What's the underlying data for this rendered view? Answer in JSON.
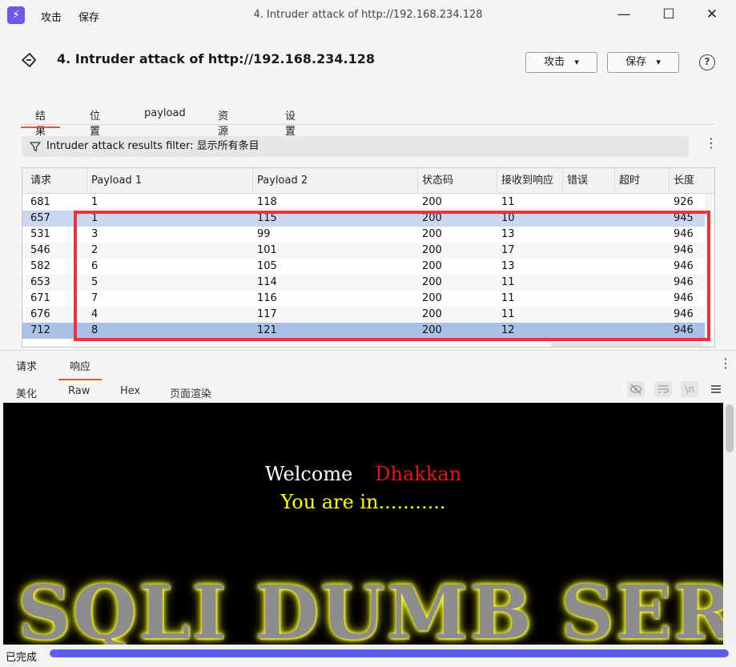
{
  "titlebar": {
    "menu": [
      "攻击",
      "保存"
    ],
    "window_title": "4. Intruder attack of http://192.168.234.128"
  },
  "header": {
    "title": "4. Intruder attack of http://192.168.234.128",
    "attack_button": "攻击",
    "save_button": "保存",
    "help": "?"
  },
  "tabs": [
    {
      "label": "结果",
      "active": true
    },
    {
      "label": "位置"
    },
    {
      "label": "payload"
    },
    {
      "label": "资源池"
    },
    {
      "label": "设置"
    }
  ],
  "filter": {
    "text": "Intruder attack results filter: 显示所有条目"
  },
  "table": {
    "columns": [
      "请求",
      "Payload 1",
      "Payload 2",
      "状态码",
      "接收到响应",
      "错误",
      "超时",
      "长度"
    ],
    "rows": [
      [
        "681",
        "1",
        "118",
        "200",
        "11",
        "",
        "",
        "926"
      ],
      [
        "657",
        "1",
        "115",
        "200",
        "10",
        "",
        "",
        "945"
      ],
      [
        "531",
        "3",
        "99",
        "200",
        "13",
        "",
        "",
        "946"
      ],
      [
        "546",
        "2",
        "101",
        "200",
        "17",
        "",
        "",
        "946"
      ],
      [
        "582",
        "6",
        "105",
        "200",
        "13",
        "",
        "",
        "946"
      ],
      [
        "653",
        "5",
        "114",
        "200",
        "11",
        "",
        "",
        "946"
      ],
      [
        "671",
        "7",
        "116",
        "200",
        "11",
        "",
        "",
        "946"
      ],
      [
        "676",
        "4",
        "117",
        "200",
        "11",
        "",
        "",
        "946"
      ],
      [
        "712",
        "8",
        "121",
        "200",
        "12",
        "",
        "",
        "946"
      ]
    ]
  },
  "lower": {
    "subtabs": [
      {
        "label": "请求"
      },
      {
        "label": "响应",
        "active": true
      }
    ],
    "viewtabs": [
      {
        "label": "美化"
      },
      {
        "label": "Raw"
      },
      {
        "label": "Hex"
      },
      {
        "label": "页面渲染",
        "active": true
      }
    ],
    "tool_icons": [
      "eye-off-icon",
      "wrap-icon",
      "newline-icon",
      "menu-lines-icon"
    ]
  },
  "render": {
    "welcome": "Welcome",
    "name": "Dhakkan",
    "you_in": "You are in...........",
    "banner": "SQLI DUMB SERIES"
  },
  "status": {
    "text": "已完成",
    "progress": 1.0
  },
  "colors": {
    "accent": "#e8572b",
    "highlight_box": "#e8333a",
    "selected_row": "#a9c1e6",
    "progress": "#5d5df0"
  }
}
